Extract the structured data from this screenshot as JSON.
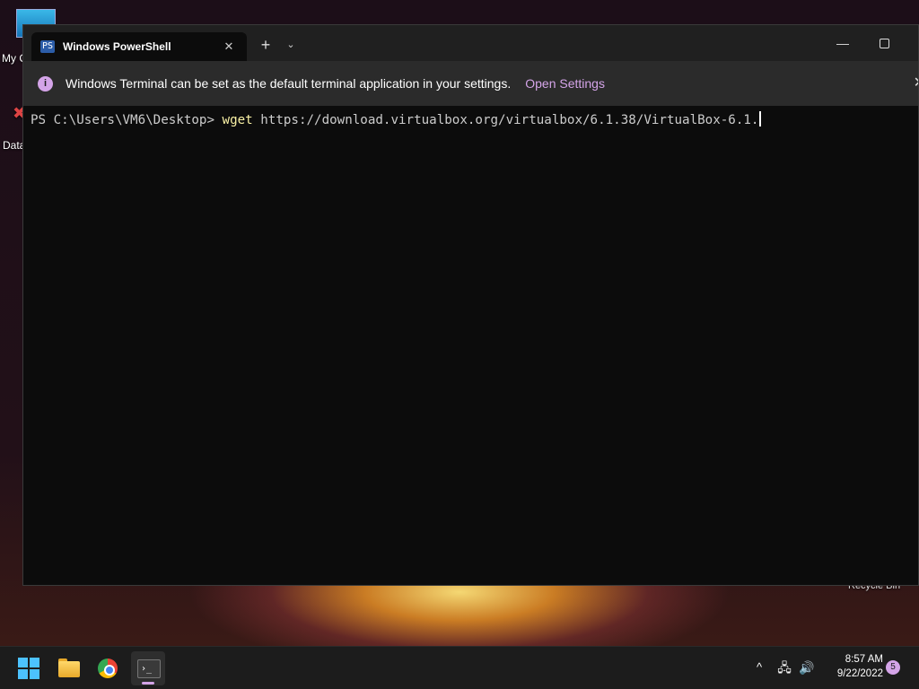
{
  "desktop": {
    "icons": [
      {
        "label": "My C",
        "icon": "this-pc-icon"
      },
      {
        "label": "Data",
        "icon": "shortcut-icon"
      },
      {
        "label": "Recycle Bin",
        "icon": "recycle-bin-icon"
      }
    ]
  },
  "window": {
    "tab_title": "Windows PowerShell",
    "tab_icon": "PS",
    "close_tab_glyph": "✕",
    "new_tab_glyph": "+",
    "dropdown_glyph": "⌄",
    "minimize_glyph": "—",
    "infobar": {
      "icon": "i",
      "message": "Windows Terminal can be set as the default terminal application in your settings.",
      "link": "Open Settings",
      "close_glyph": "✕"
    },
    "terminal": {
      "prompt": "PS C:\\Users\\VM6\\Desktop> ",
      "command": "wget",
      "args": " https://download.virtualbox.org/virtualbox/6.1.38/VirtualBox-6.1."
    }
  },
  "taskbar": {
    "apps": [
      {
        "name": "Start",
        "icon": "windows-logo-icon"
      },
      {
        "name": "File Explorer",
        "icon": "folder-icon"
      },
      {
        "name": "Google Chrome",
        "icon": "chrome-icon"
      },
      {
        "name": "Terminal",
        "icon": "terminal-icon",
        "glyph": "›_",
        "active": true
      }
    ],
    "tray": {
      "chevron": "^",
      "network_glyph": "🖧",
      "volume_glyph": "🔊",
      "time": "8:57 AM",
      "date": "9/22/2022",
      "notification_count": "5"
    }
  },
  "colors": {
    "accent": "#d4a4e8",
    "terminal_bg": "#0c0c0c",
    "command": "#f9f1a5",
    "text": "#cccccc"
  }
}
